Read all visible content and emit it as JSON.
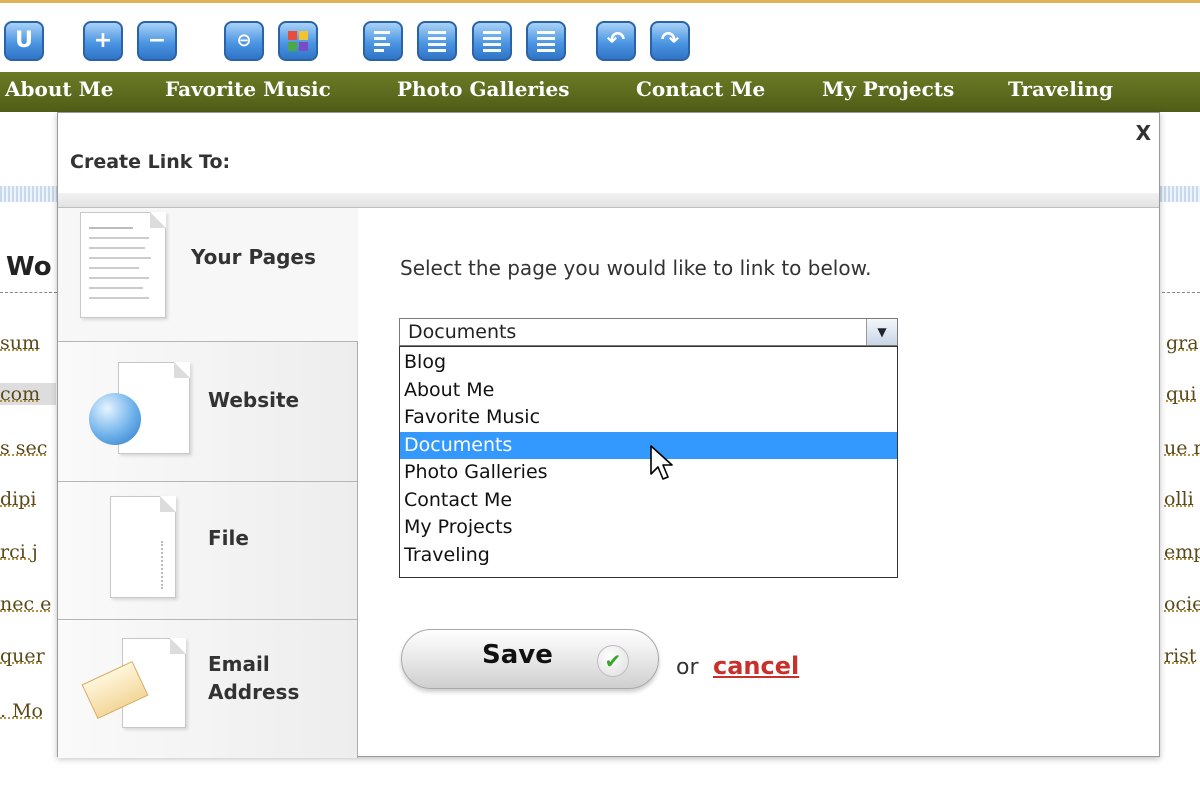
{
  "toolbar": {
    "buttons": [
      {
        "icon": "underline-icon",
        "glyph": "U"
      },
      {
        "icon": "plus-icon",
        "glyph": "+"
      },
      {
        "icon": "minus-icon",
        "glyph": "−"
      },
      {
        "icon": "strikethrough-icon",
        "glyph": "⊖"
      },
      {
        "icon": "color-grid-icon",
        "glyph": ""
      },
      {
        "icon": "align-left-icon",
        "glyph": ""
      },
      {
        "icon": "align-center-icon",
        "glyph": ""
      },
      {
        "icon": "align-right-icon",
        "glyph": ""
      },
      {
        "icon": "align-justify-icon",
        "glyph": ""
      },
      {
        "icon": "undo-icon",
        "glyph": "↶"
      },
      {
        "icon": "redo-icon",
        "glyph": "↷"
      }
    ]
  },
  "nav": {
    "items": [
      "About Me",
      "Favorite Music",
      "Photo Galleries",
      "Contact Me",
      "My Projects",
      "Traveling"
    ]
  },
  "background": {
    "heading_fragment": "Wo",
    "left_fragments": [
      "sum",
      "com",
      "s sec",
      "dipi",
      "rci j",
      "nec e",
      "quer",
      ". Mo"
    ],
    "right_fragments": [
      "gra",
      "qui",
      "ue r",
      "olli",
      "emp",
      "ocie",
      "rist"
    ]
  },
  "dialog": {
    "title": "Create Link To:",
    "close_label": "X",
    "tabs": [
      {
        "label": "Your Pages",
        "icon": "document-page-icon",
        "active": true
      },
      {
        "label": "Website",
        "icon": "globe-document-icon",
        "active": false
      },
      {
        "label": "File",
        "icon": "blank-file-icon",
        "active": false
      },
      {
        "label": "Email Address",
        "icon": "envelope-document-icon",
        "active": false
      }
    ],
    "instruction": "Select the page you would like to link to below.",
    "select": {
      "value": "Documents",
      "options": [
        "Blog",
        "About Me",
        "Favorite Music",
        "Documents",
        "Photo Galleries",
        "Contact Me",
        "My Projects",
        "Traveling"
      ],
      "highlighted": "Documents"
    },
    "save_label": "Save",
    "or_text": "or",
    "cancel_label": "cancel"
  },
  "colors": {
    "nav_bg": "#5b6b1f",
    "highlight": "#3399ff",
    "cancel": "#c9302c",
    "toolbar_button": "#4c96e3"
  }
}
